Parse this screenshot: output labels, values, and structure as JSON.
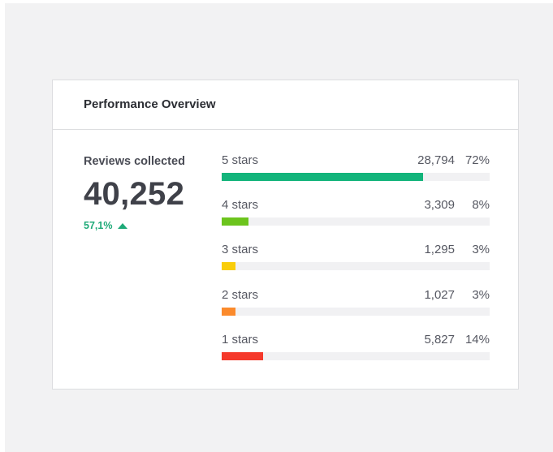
{
  "card": {
    "title": "Performance Overview"
  },
  "summary": {
    "label": "Reviews collected",
    "value": "40,252",
    "change": "57,1%",
    "trend": "up",
    "trend_icon": "triangle-up-icon",
    "trend_color": "#1eaa78"
  },
  "ratings": [
    {
      "label": "5 stars",
      "count": "28,794",
      "percent": "72%",
      "fill": 0.75,
      "color": "#13b47b"
    },
    {
      "label": "4 stars",
      "count": "3,309",
      "percent": "8%",
      "fill": 0.1,
      "color": "#6cc41d"
    },
    {
      "label": "3 stars",
      "count": "1,295",
      "percent": "3%",
      "fill": 0.05,
      "color": "#f9cd0a"
    },
    {
      "label": "2 stars",
      "count": "1,027",
      "percent": "3%",
      "fill": 0.05,
      "color": "#fb8a2c"
    },
    {
      "label": "1 stars",
      "count": "5,827",
      "percent": "14%",
      "fill": 0.155,
      "color": "#f5392b"
    }
  ]
}
